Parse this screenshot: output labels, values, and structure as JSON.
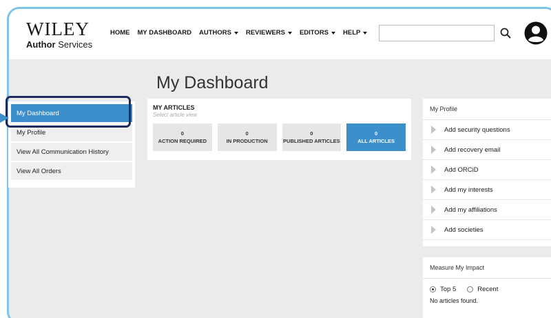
{
  "logo": {
    "name": "WILEY",
    "sub_bold": "Author",
    "sub_rest": " Services"
  },
  "nav": [
    {
      "label": "HOME",
      "dropdown": false
    },
    {
      "label": "MY DASHBOARD",
      "dropdown": false
    },
    {
      "label": "AUTHORS",
      "dropdown": true
    },
    {
      "label": "REVIEWERS",
      "dropdown": true
    },
    {
      "label": "EDITORS",
      "dropdown": true
    },
    {
      "label": "HELP",
      "dropdown": true
    }
  ],
  "search": {
    "placeholder": "",
    "value": ""
  },
  "page_title": "My Dashboard",
  "sidebar": {
    "items": [
      {
        "label": "My Dashboard",
        "active": true
      },
      {
        "label": "My Profile",
        "active": false
      },
      {
        "label": "View All Communication History",
        "active": false
      },
      {
        "label": "View All Orders",
        "active": false
      }
    ]
  },
  "articles": {
    "title": "MY ARTICLES",
    "subtitle": "Select article view",
    "tiles": [
      {
        "count": "0",
        "label": "ACTION REQUIRED",
        "active": false
      },
      {
        "count": "0",
        "label": "IN PRODUCTION",
        "active": false
      },
      {
        "count": "0",
        "label": "PUBLISHED ARTICLES",
        "active": false
      },
      {
        "count": "0",
        "label": "ALL ARTICLES",
        "active": true
      }
    ]
  },
  "profile_panel": {
    "title": "My Profile",
    "items": [
      "Add security questions",
      "Add recovery email",
      "Add ORCiD",
      "Add my interests",
      "Add my affiliations",
      "Add societies"
    ]
  },
  "impact_panel": {
    "title": "Measure My Impact",
    "option_top": "Top 5",
    "option_recent": "Recent",
    "empty_text": "No articles found."
  },
  "colors": {
    "accent": "#3d8fcc",
    "highlight": "#1d2b5e",
    "frame": "#7fc4e8",
    "background": "#ebebeb"
  }
}
